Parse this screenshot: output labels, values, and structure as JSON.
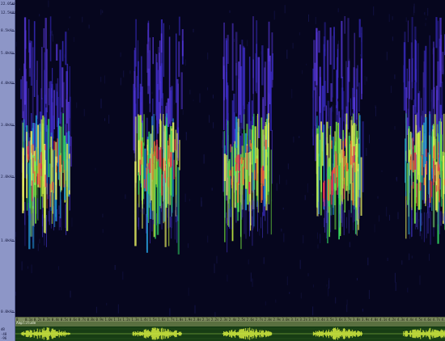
{
  "window": {
    "colors": {
      "background": "#06061e",
      "ruler": "#8d96c7",
      "amplitude_bg": "#173d14",
      "waveform": "#d8f040"
    }
  },
  "frequency_axis": {
    "labels": [
      "22.05kHz",
      "12.5kHz",
      "8.5kHz",
      "5.0kHz",
      "4.0kHz",
      "3.0kHz",
      "2.0kHz",
      "1.0kHz",
      "0.0kHz"
    ]
  },
  "time_axis": {
    "labels": [
      "0",
      "0.1s",
      "0.2s",
      "0.3s",
      "0.4s",
      "0.5s",
      "0.6s",
      "0.7s",
      "0.8s",
      "0.9s",
      "1.0s",
      "1.1s",
      "1.2s",
      "1.3s",
      "1.4s",
      "1.5s",
      "1.6s",
      "1.7s",
      "1.8s",
      "1.9s",
      "2.0s",
      "2.1s",
      "2.2s",
      "2.3s",
      "2.4s",
      "2.5s",
      "2.6s",
      "2.7s",
      "2.8s",
      "2.9s",
      "3.0s",
      "3.1s",
      "3.2s",
      "3.3s",
      "3.4s",
      "3.5s",
      "3.6s",
      "3.7s",
      "3.8s",
      "3.9s",
      "4.0s",
      "4.1s",
      "4.2s",
      "4.3s",
      "4.4s",
      "4.5s",
      "4.6s",
      "4.7s",
      "4.8s"
    ]
  },
  "amplitude": {
    "label": "Amplitude",
    "side_labels": [
      "dB",
      "-48",
      "-96"
    ]
  },
  "bursts": {
    "count": 5,
    "centers_fraction": [
      0.07,
      0.33,
      0.54,
      0.75,
      0.96
    ]
  }
}
